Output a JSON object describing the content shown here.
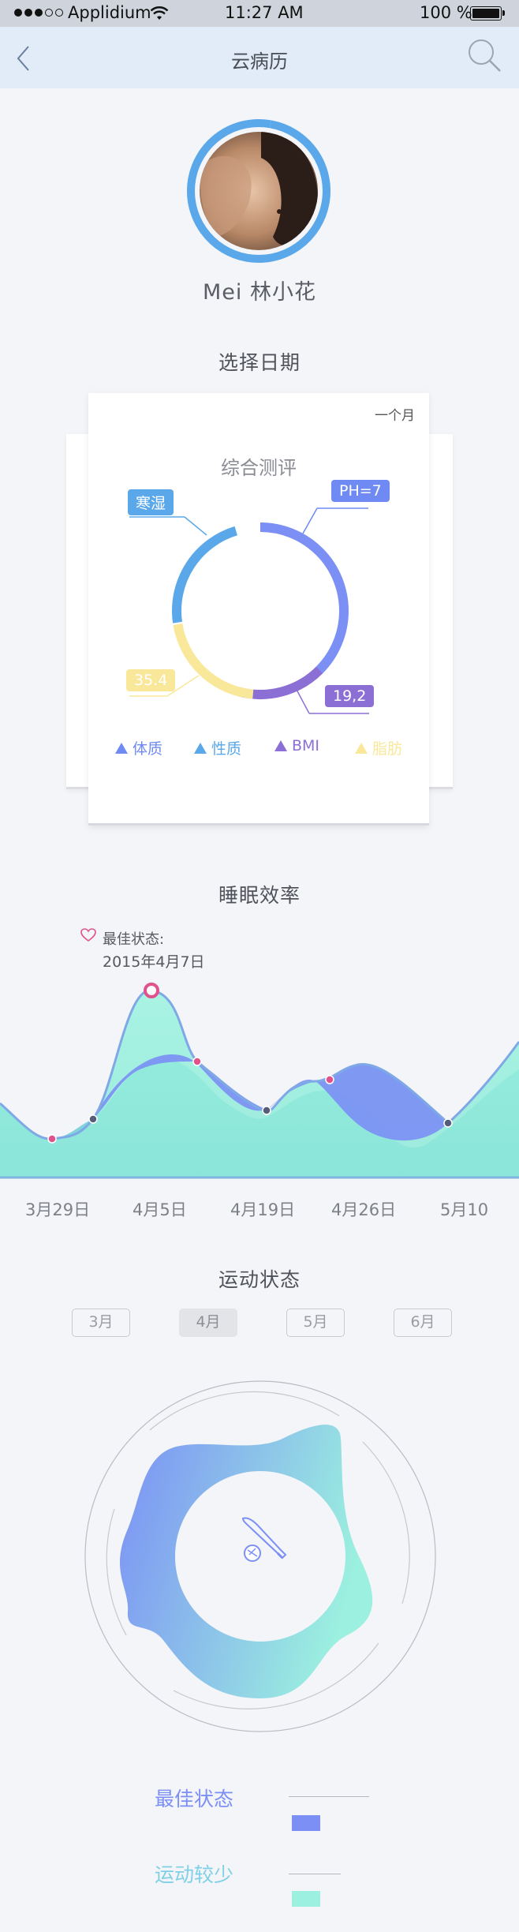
{
  "status_bar": {
    "carrier": "Applidium",
    "time": "11:27 AM",
    "battery": "100 %"
  },
  "nav": {
    "title": "云病历",
    "back_icon": "chevron-left-icon",
    "search_icon": "search-icon"
  },
  "profile": {
    "name": "Mei  林小花",
    "ring_color": "#5aa8ea"
  },
  "date_section": {
    "title": "选择日期"
  },
  "assessment_card": {
    "period": "一个月",
    "title": "综合测评",
    "tags": [
      {
        "label": "寒湿",
        "color": "#5aa8ea"
      },
      {
        "label": "PH=7",
        "color": "#6f8af2"
      },
      {
        "label": "35.4",
        "color": "#f9e89a"
      },
      {
        "label": "19,2",
        "color": "#8c6fd4"
      }
    ],
    "legend": [
      {
        "label": "体质",
        "color": "#6f8af2"
      },
      {
        "label": "性质",
        "color": "#5aa8ea"
      },
      {
        "label": "BMI",
        "color": "#8c6fd4"
      },
      {
        "label": "脂肪",
        "color": "#f9e89a"
      }
    ]
  },
  "sleep_section": {
    "title": "睡眠效率",
    "best_label": "最佳状态:",
    "best_date": "2015年4月7日",
    "x_ticks": [
      "3月29日",
      "4月5日",
      "4月19日",
      "4月26日",
      "5月10"
    ]
  },
  "exercise_section": {
    "title": "运动状态",
    "months": [
      "3月",
      "4月",
      "5月",
      "6月"
    ],
    "selected_month": "4月",
    "center_icon": "baseball-bat-icon"
  },
  "bottom_legend": {
    "items": [
      {
        "label": "最佳状态",
        "color": "#7b8ff5"
      },
      {
        "label": "运动较少",
        "color": "#9bf0df"
      }
    ]
  }
}
